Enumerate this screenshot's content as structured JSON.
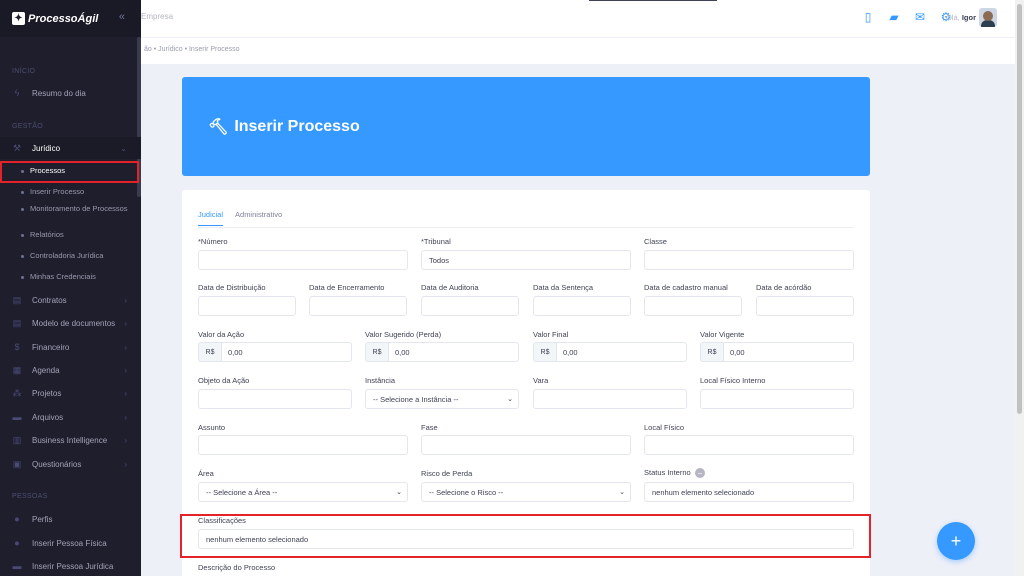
{
  "brand": {
    "name": "ProcessoÁgil",
    "logo_glyph": "✦"
  },
  "topbar": {
    "company": "Empresa",
    "greeting": "Olá,",
    "user": "Igor"
  },
  "breadcrumb": "ão • Jurídico • Inserir Processo",
  "sidebar": {
    "section_inicio": "INÍCIO",
    "resumo": "Resumo do dia",
    "section_gestao": "GESTÃO",
    "juridico": "Jurídico",
    "sub": {
      "processos": "Processos",
      "inserir": "Inserir Processo",
      "monitoramento": "Monitoramento de Processos",
      "relatorios": "Relatórios",
      "controladoria": "Controladoria Jurídica",
      "credenciais": "Minhas Credenciais"
    },
    "contratos": "Contratos",
    "modelo": "Modelo de documentos",
    "financeiro": "Financeiro",
    "agenda": "Agenda",
    "projetos": "Projetos",
    "arquivos": "Arquivos",
    "bi": "Business Intelligence",
    "questionarios": "Questionários",
    "section_pessoas": "PESSOAS",
    "perfis": "Perfis",
    "pessoa_fisica": "Inserir Pessoa Física",
    "pessoa_juridica": "Inserir Pessoa Jurídica"
  },
  "page": {
    "title": "Inserir Processo",
    "tabs": {
      "judicial": "Judicial",
      "administrativo": "Administrativo"
    }
  },
  "form": {
    "numero_label": "*Número",
    "tribunal_label": "*Tribunal",
    "tribunal_value": "Todos",
    "classe_label": "Classe",
    "dt_distribuicao": "Data de Distribuição",
    "dt_encerramento": "Data de Encerramento",
    "dt_auditoria": "Data de Auditoria",
    "dt_sentenca": "Data da Sentença",
    "dt_cadastro": "Data de cadastro manual",
    "dt_acordao": "Data de acórdão",
    "valor_acao": "Valor da Ação",
    "valor_sugerido": "Valor Sugerido (Perda)",
    "valor_final": "Valor Final",
    "valor_vigente": "Valor Vigente",
    "currency": "R$",
    "zero": "0,00",
    "objeto_label": "Objeto da Ação",
    "instancia_label": "Instância",
    "instancia_value": "-- Selecione a Instância --",
    "vara_label": "Vara",
    "local_interno_label": "Local Físico Interno",
    "assunto_label": "Assunto",
    "fase_label": "Fase",
    "local_fisico_label": "Local Físico",
    "area_label": "Área",
    "area_value": "-- Selecione a Área --",
    "risco_label": "Risco de Perda",
    "risco_value": "-- Selecione o Risco --",
    "status_label": "Status Interno",
    "status_value": "nenhum elemento selecionado",
    "classificacoes_label": "Classificações",
    "classificacoes_value": "nenhum elemento selecionado",
    "descricao_label": "Descrição do Processo"
  },
  "colors": {
    "accent": "#3699ff",
    "sidebar": "#1e1e2d",
    "highlight": "#e3222a"
  }
}
